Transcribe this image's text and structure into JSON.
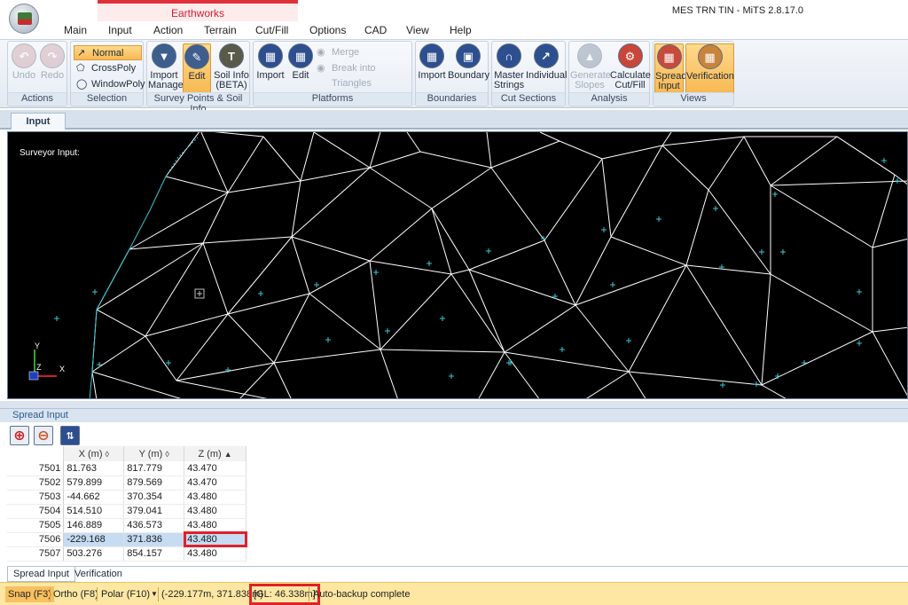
{
  "window": {
    "title": "MES TRN TIN - MiTS 2.8.17.0",
    "context_group": "Earthworks"
  },
  "menu": {
    "tabs": [
      "Main",
      "Input",
      "Action",
      "Terrain",
      "Cut/Fill",
      "Options",
      "CAD",
      "View",
      "Help"
    ]
  },
  "ribbon": {
    "actions": {
      "label": "Actions",
      "undo": "Undo",
      "redo": "Redo"
    },
    "selection": {
      "label": "Selection",
      "normal": "Normal",
      "crosspoly": "CrossPoly",
      "windowpoly": "WindowPoly"
    },
    "survey": {
      "label": "Survey Points & Soil Info",
      "import_manage_1": "Import",
      "import_manage_2": "Manage",
      "edit": "Edit",
      "soil_1": "Soil Info",
      "soil_2": "(BETA)"
    },
    "platforms": {
      "label": "Platforms",
      "import": "Import",
      "edit": "Edit",
      "merge": "Merge",
      "break": "Break into Triangles"
    },
    "boundaries": {
      "label": "Boundaries",
      "import": "Import",
      "boundary": "Boundary"
    },
    "cut_sections": {
      "label": "Cut Sections",
      "master_1": "Master",
      "master_2": "Strings",
      "individual": "Individual"
    },
    "analysis": {
      "label": "Analysis",
      "generate_1": "Generate",
      "generate_2": "Slopes",
      "calc_1": "Calculate",
      "calc_2": "Cut/Fill"
    },
    "views": {
      "label": "Views",
      "spread_1": "Spread",
      "spread_2": "Input",
      "verification": "Verification"
    }
  },
  "document": {
    "tab": "Input",
    "canvas_label": "Surveyor Input:",
    "axis_y": "Y",
    "axis_z": "Z",
    "axis_x": "X"
  },
  "spread": {
    "title": "Spread Input",
    "columns": [
      "X (m)",
      "Y (m)",
      "Z (m)"
    ],
    "rows": [
      {
        "id": "7501",
        "x": "81.763",
        "y": "817.779",
        "z": "43.470"
      },
      {
        "id": "7502",
        "x": "579.899",
        "y": "879.569",
        "z": "43.470"
      },
      {
        "id": "7503",
        "x": "-44.662",
        "y": "370.354",
        "z": "43.480"
      },
      {
        "id": "7504",
        "x": "514.510",
        "y": "379.041",
        "z": "43.480"
      },
      {
        "id": "7505",
        "x": "146.889",
        "y": "436.573",
        "z": "43.480"
      },
      {
        "id": "7506",
        "x": "-229.168",
        "y": "371.836",
        "z": "43.480"
      },
      {
        "id": "7507",
        "x": "503.276",
        "y": "854.157",
        "z": "43.480"
      }
    ],
    "tabs": [
      "Spread Input",
      "Verification"
    ]
  },
  "status": {
    "snap": "Snap (F3)",
    "ortho": "Ortho (F8)",
    "polar": "Polar (F10)",
    "coords": "(-229.177m, 371.838m)",
    "gl": "[GL: 46.338m]",
    "message": "Auto-backup complete"
  },
  "colors": {
    "canvas_bg": "#000000",
    "mesh_line": "#ffffff",
    "survey_point": "#35c6d4",
    "highlight": "#e0202a",
    "active_button": "#f7b955",
    "status_bg": "#fde7a3"
  }
}
